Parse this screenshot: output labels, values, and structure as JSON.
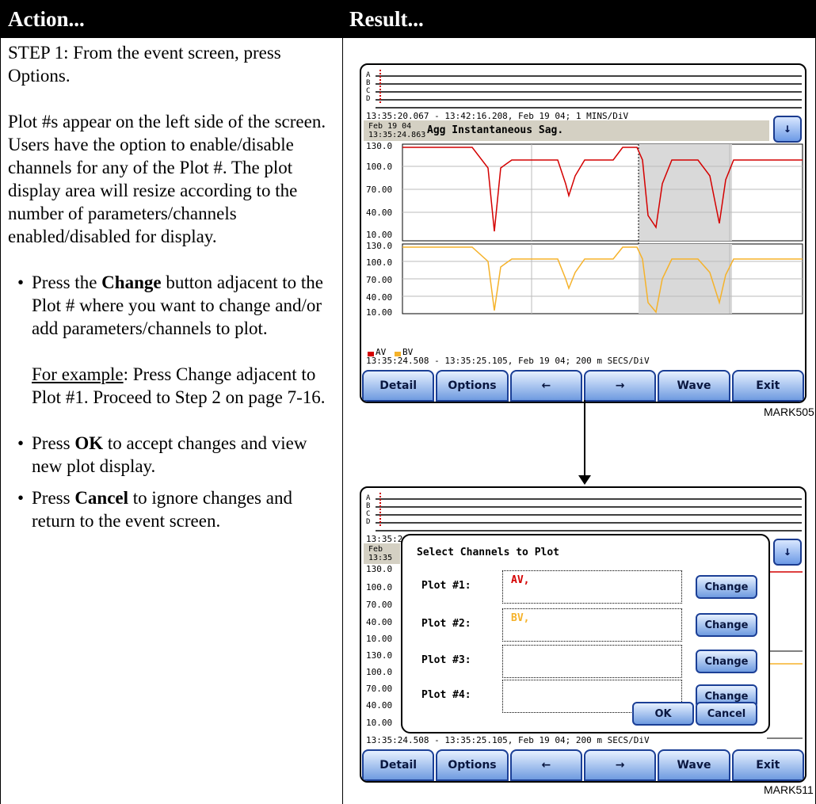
{
  "header": {
    "action": "Action...",
    "result": "Result..."
  },
  "left": {
    "step1": "STEP 1: From the event screen, press Options.",
    "plot_desc": "Plot #s appear on the left side of the screen. Users have the option to enable/disable channels for any of the Plot #. The plot display area will resize according to the number of parameters/channels enabled/disabled for display.",
    "bullet_glyph": "•",
    "b1_pre": "Press the ",
    "b1_bold": "Change",
    "b1_post": " button adjacent to the Plot # where you want to change and/or add parameters/channels to plot.",
    "example_label": "For example",
    "example_text": ": Press Change adjacent to Plot #1. Proceed to Step 2 on page 7-16.",
    "b2_pre": "Press ",
    "b2_bold": "OK",
    "b2_post": " to accept changes and view new plot display.",
    "b3_pre": "Press ",
    "b3_bold": "Cancel",
    "b3_post": " to ignore changes and return to the event screen."
  },
  "screen1": {
    "mini_labels": [
      "A",
      "B",
      "C",
      "D"
    ],
    "timeline": "13:35:20.067 - 13:42:16.208, Feb 19 04;   1 MINS/DiV",
    "event_date_line1": "Feb 19 04",
    "event_date_line2": "13:35:24.863",
    "event_title": "Agg Instantaneous Sag.",
    "axis_labels": [
      "130.0",
      "100.0",
      "70.00",
      "40.00",
      "10.00"
    ],
    "legend_av": "AV",
    "legend_bv": "BV",
    "footer_time": "13:35:24.508 - 13:35:25.105, Feb 19 04;   200 m SECS/DiV",
    "buttons": [
      "Detail",
      "Options",
      "←",
      "→",
      "Wave",
      "Exit"
    ],
    "mark": "MARK505"
  },
  "screen2": {
    "timeline_prefix": "13:35:2",
    "event_date_line1": "Feb",
    "event_date_line2": "13:35",
    "axis_labels_top": [
      "130.0",
      "100.0",
      "70.00",
      "40.00",
      "10.00"
    ],
    "axis_labels_bottom": [
      "130.0",
      "100.0",
      "70.00",
      "40.00",
      "10.00"
    ],
    "dialog_title": "Select Channels to Plot",
    "plots": [
      {
        "label": "Plot #1:",
        "value": "AV,"
      },
      {
        "label": "Plot #2:",
        "value": "BV,"
      },
      {
        "label": "Plot #3:",
        "value": ""
      },
      {
        "label": "Plot #4:",
        "value": ""
      }
    ],
    "change_label": "Change",
    "ok_label": "OK",
    "cancel_label": "Cancel",
    "footer_time": "13:35:24.508 - 13:35:25.105, Feb 19 04;   200 m SECS/DiV",
    "buttons": [
      "Detail",
      "Options",
      "←",
      "→",
      "Wave",
      "Exit"
    ],
    "mark": "MARK511"
  },
  "colors": {
    "av": "#d40000",
    "bv": "#f5b22a",
    "shade": "#d9d9d9",
    "btn_border": "#1b3f96"
  }
}
